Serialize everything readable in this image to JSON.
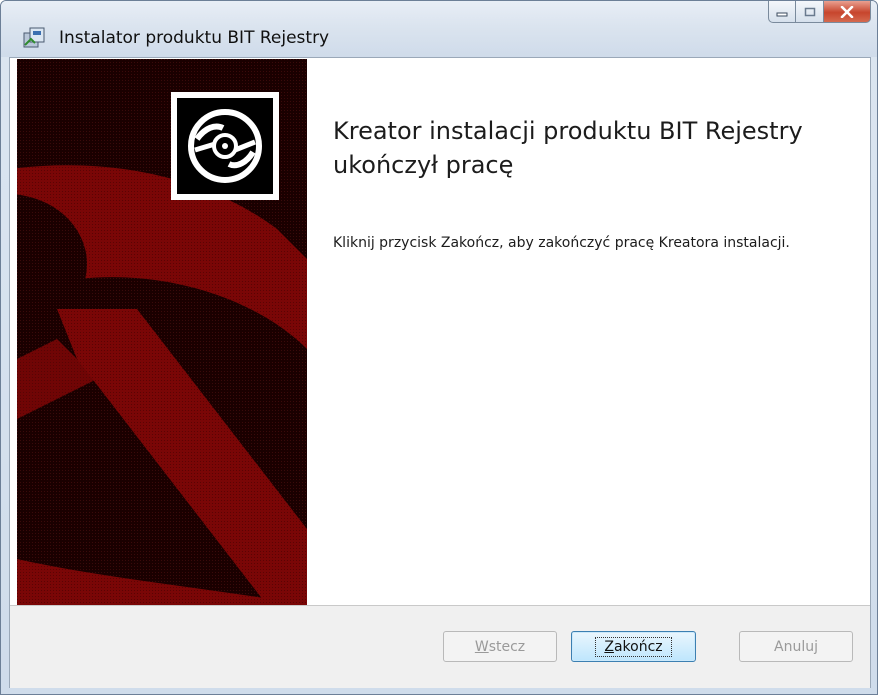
{
  "window": {
    "title": "Instalator produktu BIT Rejestry",
    "app_icon": "installer-box-icon",
    "caption_icons": [
      "minimize-icon",
      "maximize-icon",
      "close-icon"
    ]
  },
  "banner": {
    "logo_icon": "disc-icon",
    "colors": {
      "dark": "#1a0000",
      "red": "#7a0606"
    }
  },
  "content": {
    "heading_line1": "Kreator instalacji produktu BIT Rejestry",
    "heading_line2": "ukończył pracę",
    "description": "Kliknij przycisk Zakończ, aby zakończyć pracę Kreatora instalacji."
  },
  "buttons": {
    "back": {
      "accel": "W",
      "rest": "stecz",
      "enabled": false
    },
    "finish": {
      "accel": "Z",
      "rest": "akończ",
      "enabled": true,
      "default": true
    },
    "cancel": {
      "label": "Anuluj",
      "enabled": false
    }
  }
}
